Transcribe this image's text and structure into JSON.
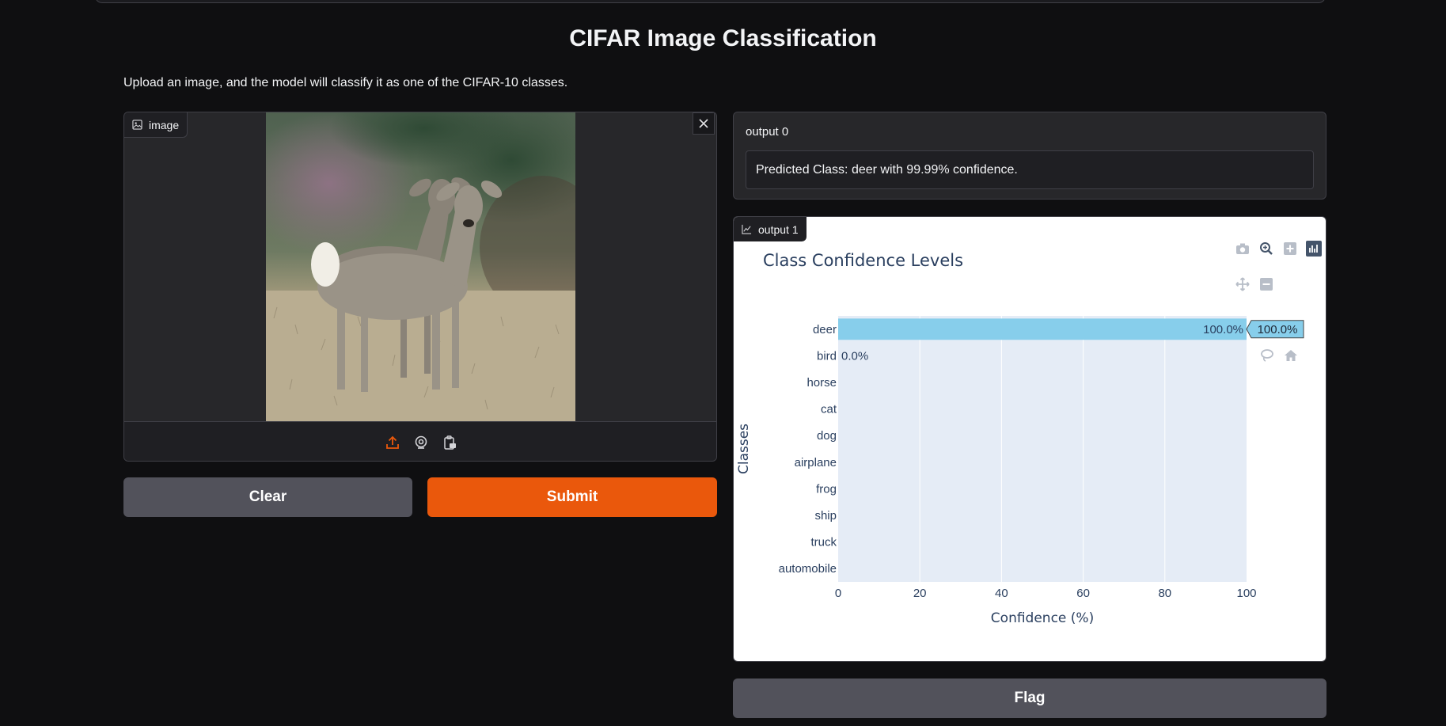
{
  "app": {
    "title": "CIFAR Image Classification",
    "description": "Upload an image, and the model will classify it as one of the CIFAR-10 classes."
  },
  "input_panel": {
    "label": "image",
    "icons": [
      "image-icon",
      "close-icon",
      "upload-icon",
      "webcam-icon",
      "clipboard-icon"
    ],
    "toolbar_active_color": "#ea580c"
  },
  "buttons": {
    "clear": "Clear",
    "submit": "Submit",
    "flag": "Flag"
  },
  "output0": {
    "label": "output 0",
    "text": "Predicted Class: deer with 99.99% confidence."
  },
  "output1": {
    "label": "output 1",
    "modebar_icons": [
      "camera-icon",
      "zoom-icon",
      "zoom-in-icon",
      "bar-chart-icon",
      "pan-icon",
      "zoom-out-icon",
      "lasso-icon",
      "home-icon"
    ]
  },
  "colors": {
    "accent": "#ea580c",
    "bar": "#87ceeb",
    "plot_bg": "#e5ecf6",
    "text_dark": "#2a3f5f"
  },
  "chart_data": {
    "type": "bar",
    "orientation": "horizontal",
    "title": "Class Confidence Levels",
    "xlabel": "Confidence (%)",
    "ylabel": "Classes",
    "categories": [
      "deer",
      "bird",
      "horse",
      "cat",
      "dog",
      "airplane",
      "frog",
      "ship",
      "truck",
      "automobile"
    ],
    "values": [
      100.0,
      0.0,
      0,
      0,
      0,
      0,
      0,
      0,
      0,
      0
    ],
    "data_labels": [
      "100.0%",
      "0.0%",
      "",
      "",
      "",
      "",
      "",
      "",
      "",
      ""
    ],
    "hover_label": "100.0%",
    "xticks": [
      "0",
      "20",
      "40",
      "60",
      "80",
      "100"
    ],
    "xlim": [
      0,
      100
    ],
    "grid": true
  }
}
